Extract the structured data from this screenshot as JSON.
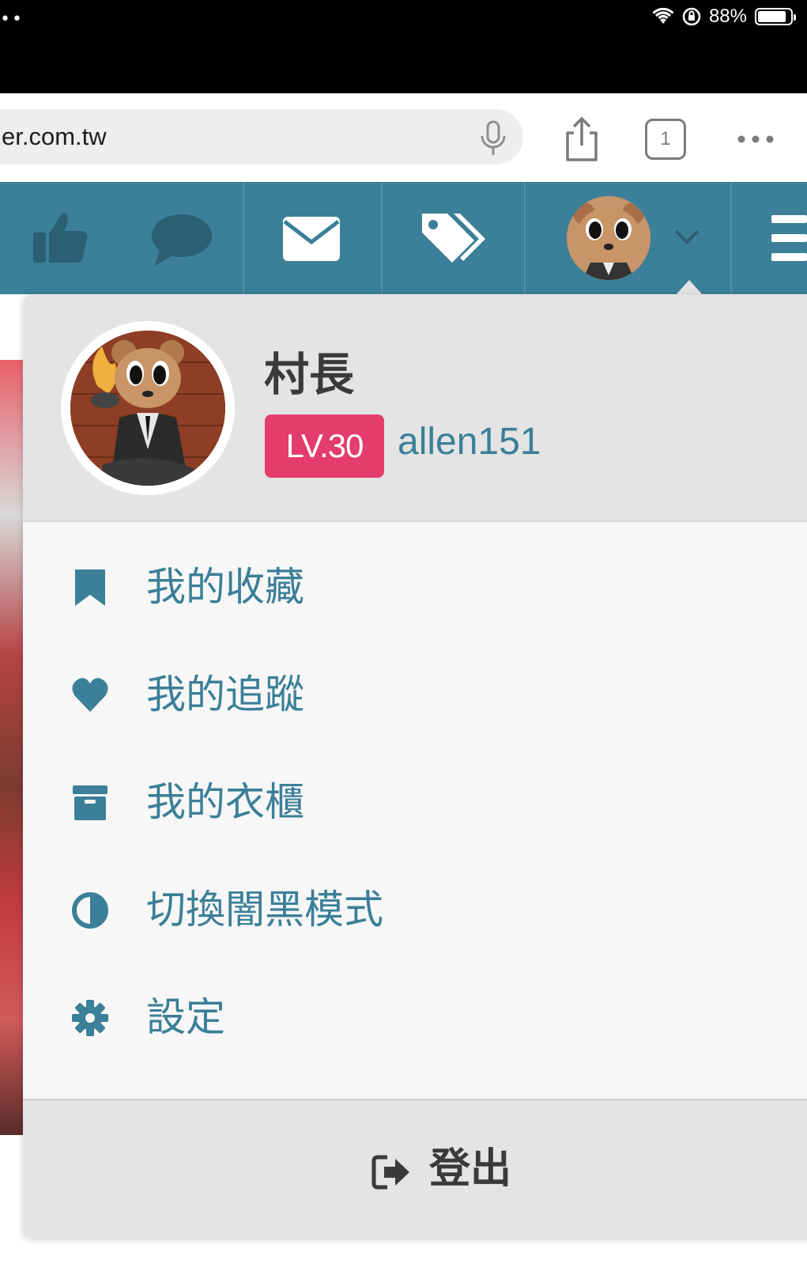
{
  "status_bar": {
    "battery_text": "88%",
    "battery_level": 0.88
  },
  "browser": {
    "url_text": "er.com.tw",
    "tab_count": "1"
  },
  "user_menu": {
    "nickname": "村長",
    "level_badge": "LV.30",
    "username": "allen151",
    "items": [
      {
        "label": "我的收藏",
        "icon": "bookmark-icon"
      },
      {
        "label": "我的追蹤",
        "icon": "heart-icon"
      },
      {
        "label": "我的衣櫃",
        "icon": "archive-box-icon"
      },
      {
        "label": "切換闇黑模式",
        "icon": "half-circle-contrast-icon"
      },
      {
        "label": "設定",
        "icon": "gear-icon"
      }
    ],
    "logout_label": "登出"
  },
  "colors": {
    "nav_bg": "#3b7f98",
    "accent_text": "#3b7f98",
    "level_badge_bg": "#e43c6c"
  }
}
